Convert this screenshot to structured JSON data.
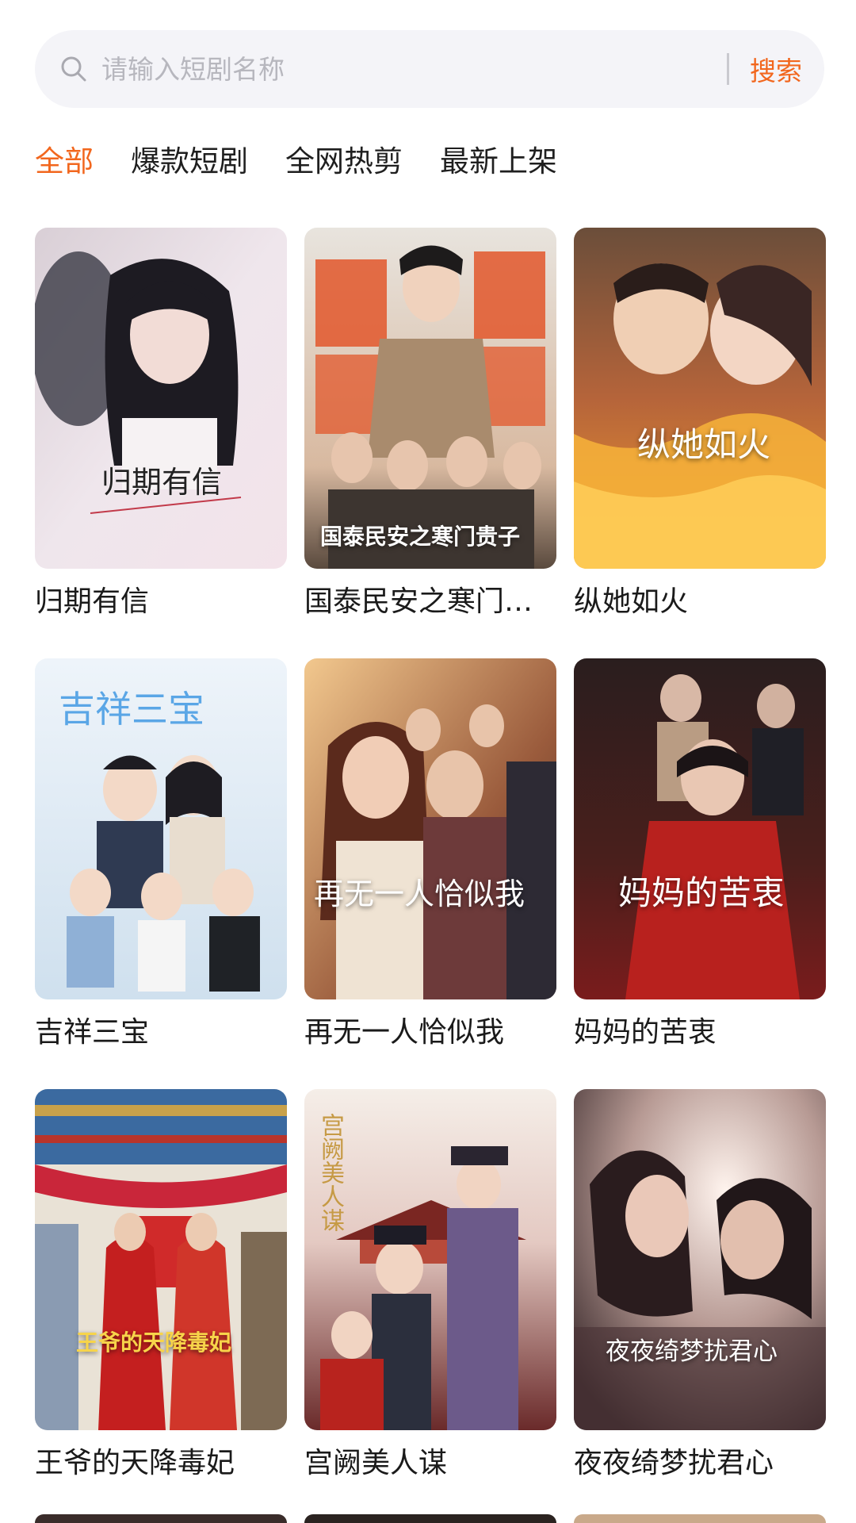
{
  "search": {
    "placeholder": "请输入短剧名称",
    "button_label": "搜索"
  },
  "tabs": [
    {
      "label": "全部",
      "active": true
    },
    {
      "label": "爆款短剧",
      "active": false
    },
    {
      "label": "全网热剪",
      "active": false
    },
    {
      "label": "最新上架",
      "active": false
    }
  ],
  "dramas": [
    {
      "title": "归期有信",
      "poster_text": "归期有信"
    },
    {
      "title": "国泰民安之寒门…",
      "poster_text": "国泰民安之寒门贵子"
    },
    {
      "title": "纵她如火",
      "poster_text": "纵她如火"
    },
    {
      "title": "吉祥三宝",
      "poster_text": "吉祥三宝"
    },
    {
      "title": "再无一人恰似我",
      "poster_text": "再无一人恰似我"
    },
    {
      "title": "妈妈的苦衷",
      "poster_text": "妈妈的苦衷"
    },
    {
      "title": "王爷的天降毒妃",
      "poster_text": "王爷的天降毒妃"
    },
    {
      "title": "宫阙美人谋",
      "poster_text": "宫阙美人谋"
    },
    {
      "title": "夜夜绮梦扰君心",
      "poster_text": "夜夜绮梦扰君心"
    }
  ],
  "colors": {
    "accent": "#f2671e",
    "search_bg": "#f4f4f8"
  }
}
